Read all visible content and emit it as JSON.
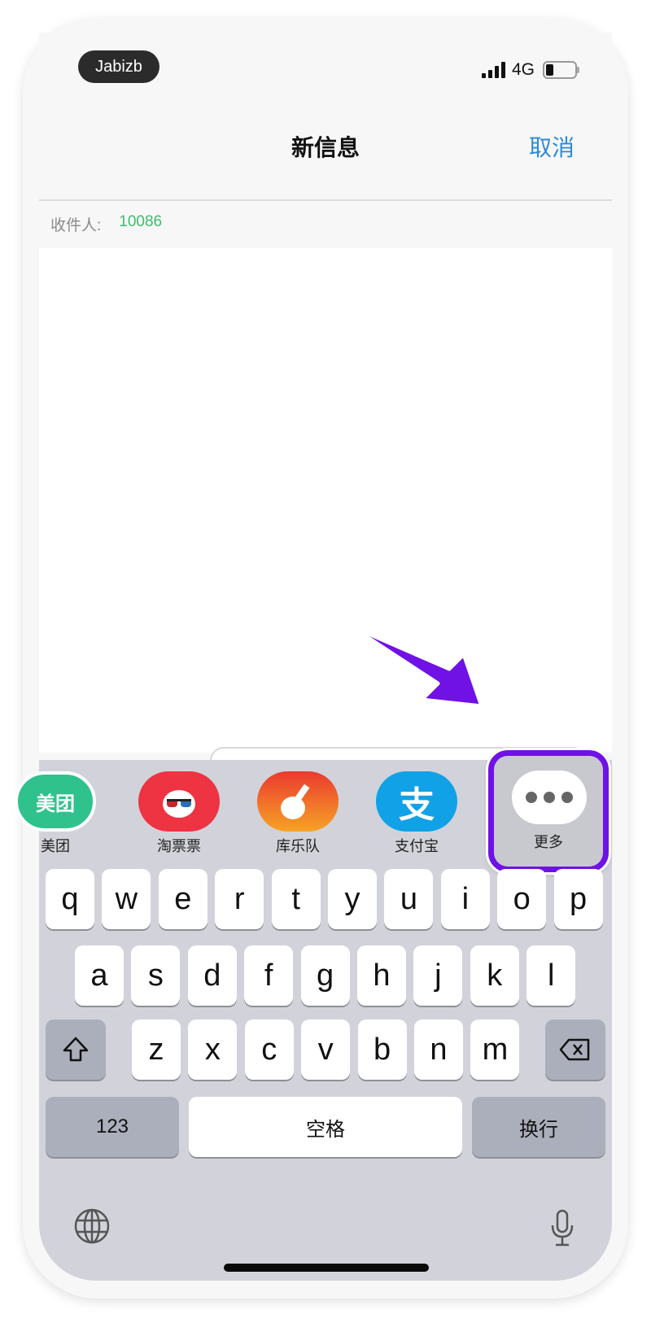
{
  "status_bar": {
    "carrier": "Jabizb",
    "network": "4G",
    "signal_bars": 4,
    "battery_level_percent": 25
  },
  "header": {
    "title": "新信息",
    "cancel_label": "取消"
  },
  "recipient": {
    "label": "收件人:",
    "value": "10086"
  },
  "app_drawer": {
    "apps": [
      {
        "name": "美团",
        "icon_text": "美团",
        "color": "#2fc28d"
      },
      {
        "name": "淘票票",
        "icon_text": "",
        "color": "#ee3342"
      },
      {
        "name": "库乐队",
        "icon_text": "",
        "color": "#f26a22"
      },
      {
        "name": "支付宝",
        "icon_text": "支",
        "color": "#11a1e6"
      },
      {
        "name": "更多",
        "icon_text": "•••",
        "color": "#ffffff"
      }
    ],
    "highlight_color": "#7011e6"
  },
  "keyboard": {
    "row1": [
      "q",
      "w",
      "e",
      "r",
      "t",
      "y",
      "u",
      "i",
      "o",
      "p"
    ],
    "row2": [
      "a",
      "s",
      "d",
      "f",
      "g",
      "h",
      "j",
      "k",
      "l"
    ],
    "row3": [
      "z",
      "x",
      "c",
      "v",
      "b",
      "n",
      "m"
    ],
    "numbers_label": "123",
    "space_label": "空格",
    "return_label": "换行"
  }
}
